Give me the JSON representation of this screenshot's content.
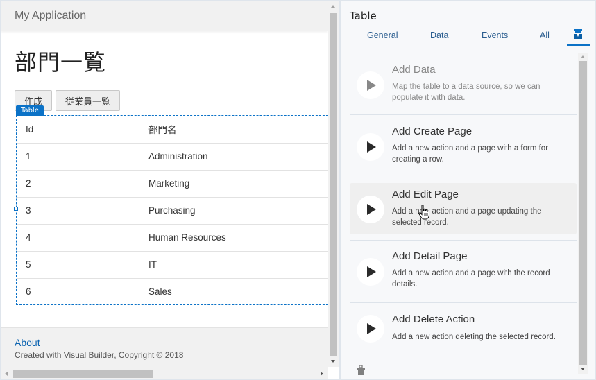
{
  "preview": {
    "app_title": "My Application",
    "page_title": "部門一覧",
    "buttons": [
      {
        "label": "作成"
      },
      {
        "label": "従業員一覧"
      }
    ],
    "table_tag": "Table",
    "table": {
      "columns": [
        "Id",
        "部門名"
      ],
      "rows": [
        {
          "id": "1",
          "name": "Administration"
        },
        {
          "id": "2",
          "name": "Marketing"
        },
        {
          "id": "3",
          "name": "Purchasing"
        },
        {
          "id": "4",
          "name": "Human Resources"
        },
        {
          "id": "5",
          "name": "IT"
        },
        {
          "id": "6",
          "name": "Sales"
        }
      ]
    },
    "footer": {
      "about_link": "About",
      "copyright": "Created with Visual Builder, Copyright © 2018"
    }
  },
  "inspector": {
    "title": "Table",
    "tabs": [
      {
        "label": "General",
        "active": false
      },
      {
        "label": "Data",
        "active": false
      },
      {
        "label": "Events",
        "active": false
      },
      {
        "label": "All",
        "active": false
      },
      {
        "icon": "quick-start-icon",
        "active": true
      }
    ],
    "quick_starts": [
      {
        "title": "Add Data",
        "description": "Map the table to a data source, so we can populate it with data.",
        "enabled": false,
        "hovered": false
      },
      {
        "title": "Add Create Page",
        "description": "Add a new action and a page with a form for creating a row.",
        "enabled": true,
        "hovered": false
      },
      {
        "title": "Add Edit Page",
        "description": "Add a new action and a page updating the selected record.",
        "enabled": true,
        "hovered": true
      },
      {
        "title": "Add Detail Page",
        "description": "Add a new action and a page with the record details.",
        "enabled": true,
        "hovered": false
      },
      {
        "title": "Add Delete Action",
        "description": "Add a new action deleting the selected record.",
        "enabled": true,
        "hovered": false
      }
    ],
    "footer_icon": "trash-icon"
  },
  "colors": {
    "accent": "#0b72c7",
    "link": "#0b63b0",
    "tab_text": "#2a5d8f",
    "header_bg": "#f1f1f1",
    "inspector_bg": "#f7f8fa"
  }
}
